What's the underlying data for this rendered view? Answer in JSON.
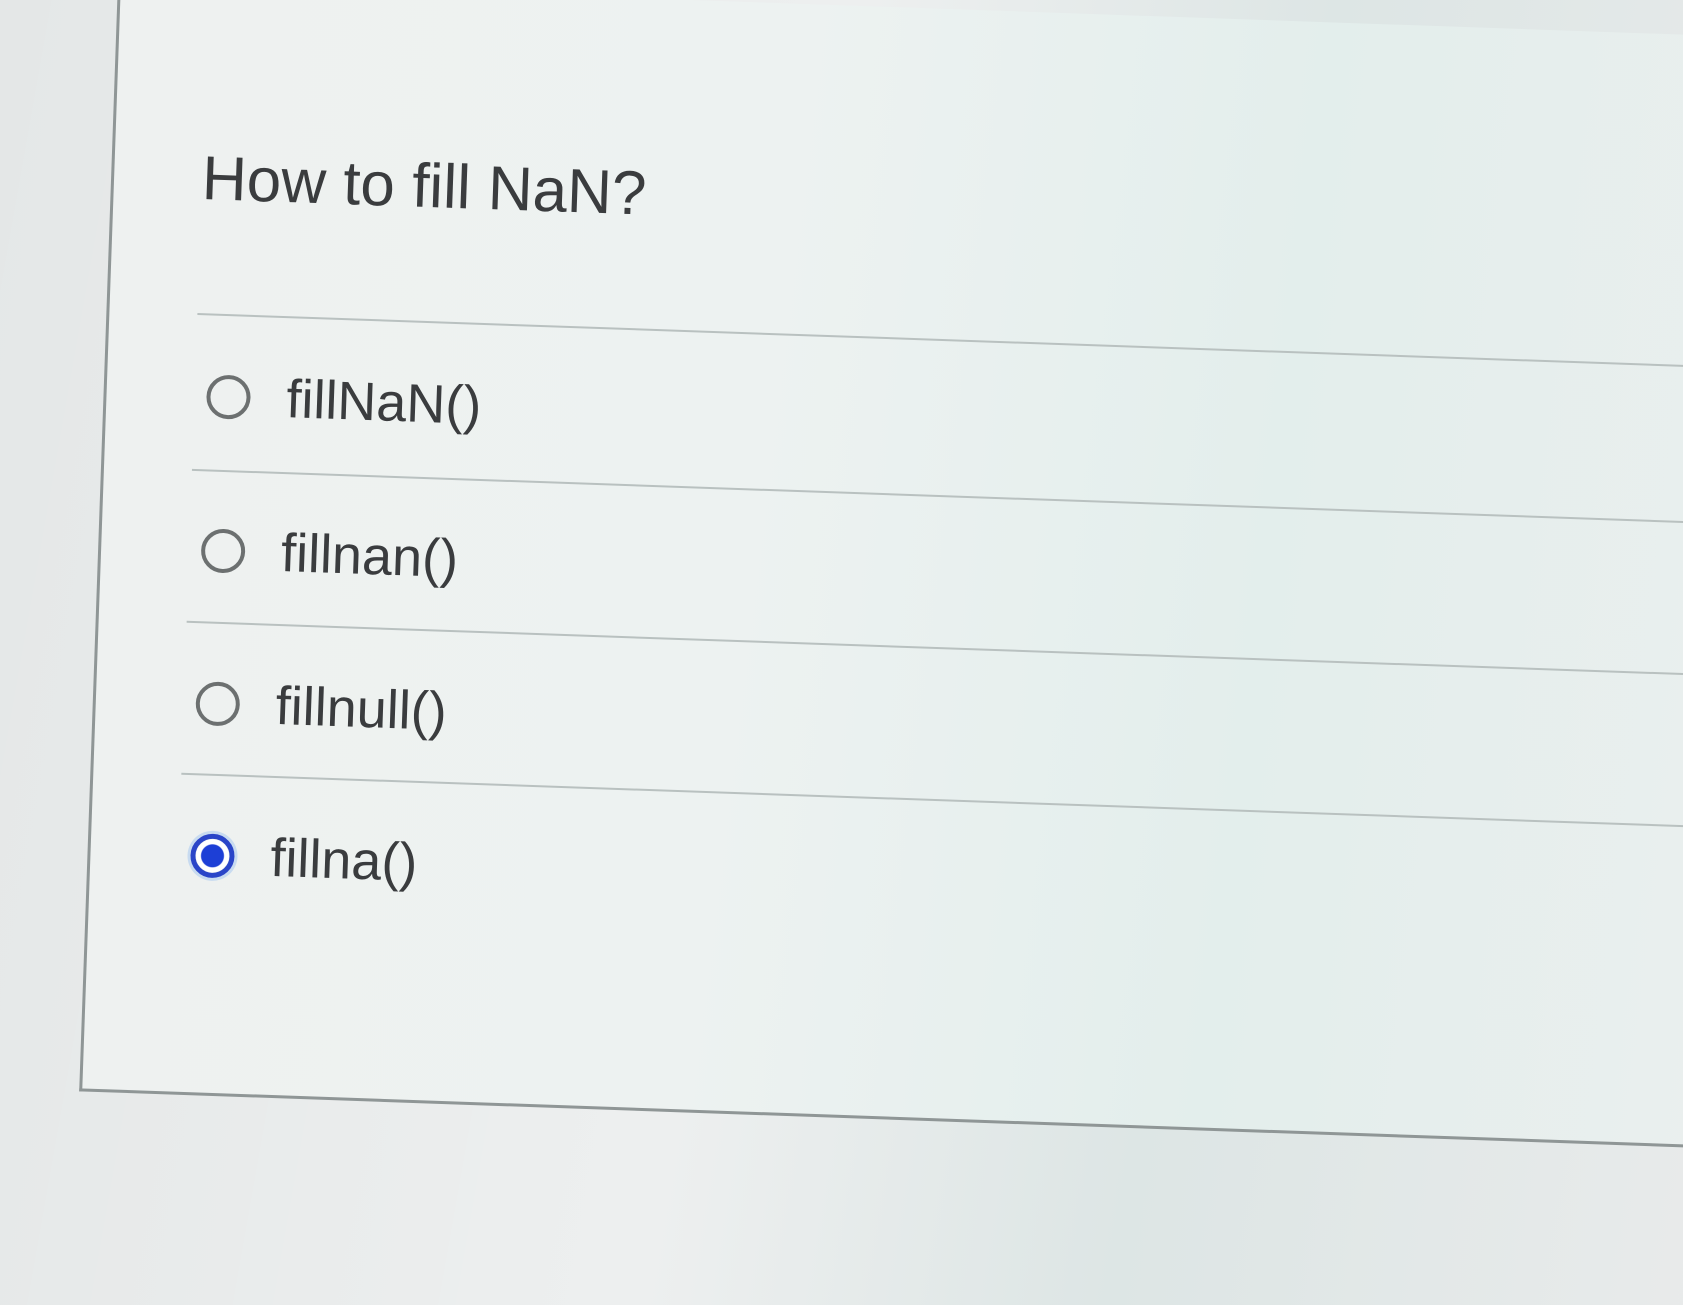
{
  "question": {
    "title": "How to fill NaN?",
    "options": [
      {
        "label": "fillNaN()",
        "selected": false
      },
      {
        "label": "fillnan()",
        "selected": false
      },
      {
        "label": "fillnull()",
        "selected": false
      },
      {
        "label": "fillna()",
        "selected": true
      }
    ],
    "accent_color": "#1d3fd6"
  }
}
